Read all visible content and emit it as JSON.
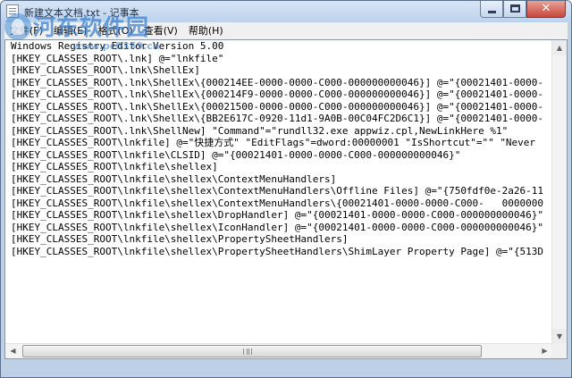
{
  "window": {
    "title": "新建文本文档.txt - 记事本",
    "close_glyph": "✕"
  },
  "watermark": {
    "title": "河东软件园",
    "subtitle": "www.pc0359.cn"
  },
  "menu": [
    {
      "label": "文件(F)"
    },
    {
      "label": "编辑(E)"
    },
    {
      "label": "格式(O)"
    },
    {
      "label": "查看(V)"
    },
    {
      "label": "帮助(H)"
    }
  ],
  "content": {
    "lines": [
      "Windows Registry Editor Version 5.00",
      "[HKEY_CLASSES_ROOT\\.lnk] @=\"lnkfile\"",
      "[HKEY_CLASSES_ROOT\\.lnk\\ShellEx]",
      "[HKEY_CLASSES_ROOT\\.lnk\\ShellEx\\{000214EE-0000-0000-C000-000000000046}] @=\"{00021401-0000-",
      "[HKEY_CLASSES_ROOT\\.lnk\\ShellEx\\{000214F9-0000-0000-C000-000000000046}] @=\"{00021401-0000-",
      "[HKEY_CLASSES_ROOT\\.lnk\\ShellEx\\{00021500-0000-0000-C000-000000000046}] @=\"{00021401-0000-",
      "[HKEY_CLASSES_ROOT\\.lnk\\ShellEx\\{BB2E617C-0920-11d1-9A0B-00C04FC2D6C1}] @=\"{00021401-0000-",
      "[HKEY_CLASSES_ROOT\\.lnk\\ShellNew] \"Command\"=\"rundll32.exe appwiz.cpl,NewLinkHere %1\"",
      "[HKEY_CLASSES_ROOT\\lnkfile] @=\"快捷方式\" \"EditFlags\"=dword:00000001 \"IsShortcut\"=\"\" \"Never",
      "[HKEY_CLASSES_ROOT\\lnkfile\\CLSID] @=\"{00021401-0000-0000-C000-000000000046}\"",
      "[HKEY_CLASSES_ROOT\\lnkfile\\shellex]",
      "[HKEY_CLASSES_ROOT\\lnkfile\\shellex\\ContextMenuHandlers]",
      "[HKEY_CLASSES_ROOT\\lnkfile\\shellex\\ContextMenuHandlers\\Offline Files] @=\"{750fdf0e-2a26-11",
      "[HKEY_CLASSES_ROOT\\lnkfile\\shellex\\ContextMenuHandlers\\{00021401-0000-0000-C000-   0000000",
      "[HKEY_CLASSES_ROOT\\lnkfile\\shellex\\DropHandler] @=\"{00021401-0000-0000-C000-000000000046}\"",
      "[HKEY_CLASSES_ROOT\\lnkfile\\shellex\\IconHandler] @=\"{00021401-0000-0000-C000-000000000046}\"",
      "[HKEY_CLASSES_ROOT\\lnkfile\\shellex\\PropertySheetHandlers]",
      "[HKEY_CLASSES_ROOT\\lnkfile\\shellex\\PropertySheetHandlers\\ShimLayer Property Page] @=\"{513D"
    ]
  },
  "scrollbar": {
    "up_glyph": "▲",
    "down_glyph": "▼",
    "left_glyph": "◀",
    "right_glyph": "▶"
  }
}
